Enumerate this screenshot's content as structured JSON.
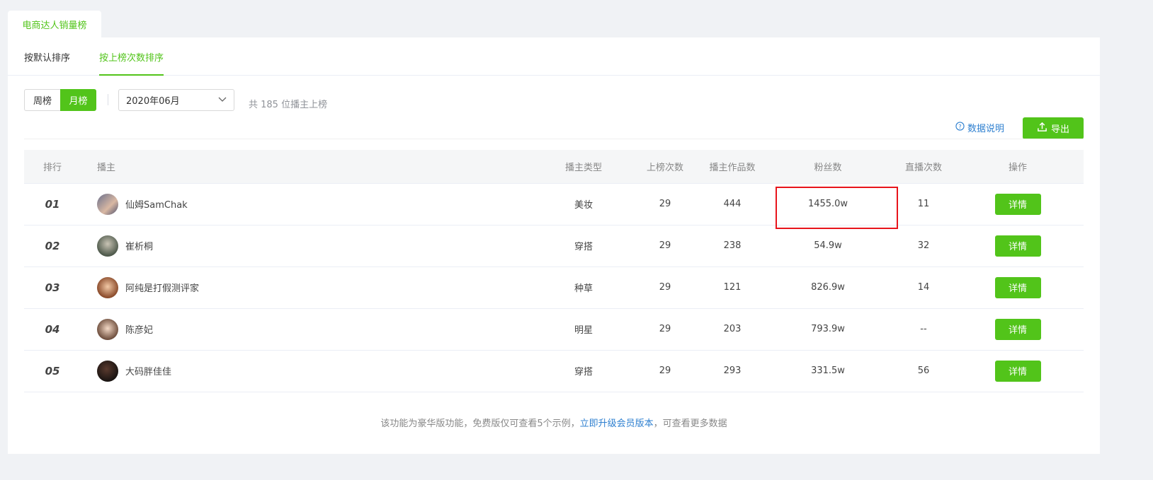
{
  "top_tab": {
    "label": "电商达人销量榜"
  },
  "sort_tabs": [
    {
      "label": "按默认排序"
    },
    {
      "label": "按上榜次数排序"
    }
  ],
  "period": {
    "weekly": "周榜",
    "monthly": "月榜",
    "selected": "月榜"
  },
  "month_select": {
    "value": "2020年06月"
  },
  "summary": {
    "text": "共 185 位播主上榜"
  },
  "data_note": {
    "label": "数据说明"
  },
  "export": {
    "label": "导出"
  },
  "table": {
    "headers": [
      "排行",
      "播主",
      "播主类型",
      "上榜次数",
      "播主作品数",
      "粉丝数",
      "直播次数",
      "操作"
    ],
    "rows": [
      {
        "rank": "01",
        "name": "仙姆SamChak",
        "type": "美妆",
        "times": "29",
        "works": "444",
        "fans": "1455.0w",
        "live": "11",
        "action": "详情"
      },
      {
        "rank": "02",
        "name": "崔析桐",
        "type": "穿搭",
        "times": "29",
        "works": "238",
        "fans": "54.9w",
        "live": "32",
        "action": "详情"
      },
      {
        "rank": "03",
        "name": "阿纯是打假测评家",
        "type": "种草",
        "times": "29",
        "works": "121",
        "fans": "826.9w",
        "live": "14",
        "action": "详情"
      },
      {
        "rank": "04",
        "name": "陈彦妃",
        "type": "明星",
        "times": "29",
        "works": "203",
        "fans": "793.9w",
        "live": "--",
        "action": "详情"
      },
      {
        "rank": "05",
        "name": "大码胖佳佳",
        "type": "穿搭",
        "times": "29",
        "works": "293",
        "fans": "331.5w",
        "live": "56",
        "action": "详情"
      }
    ]
  },
  "footer": {
    "prefix": "该功能为豪华版功能，免费版仅可查看5个示例，",
    "link": "立即升级会员版本",
    "suffix": "，可查看更多数据"
  },
  "colors": {
    "accent": "#52c41a",
    "link": "#2f80d0",
    "highlight": "#e8141b"
  }
}
